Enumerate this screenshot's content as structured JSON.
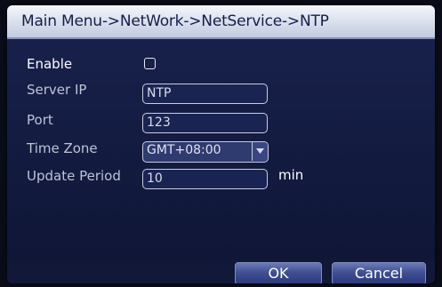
{
  "title": "Main Menu->NetWork->NetService->NTP",
  "form": {
    "enable_label": "Enable",
    "enable_checked": false,
    "server_ip_label": "Server IP",
    "server_ip_value": "NTP",
    "port_label": "Port",
    "port_value": "123",
    "time_zone_label": "Time Zone",
    "time_zone_value": "GMT+08:00",
    "update_period_label": "Update Period",
    "update_period_value": "10",
    "update_period_unit": "min"
  },
  "buttons": {
    "ok_label": "OK",
    "cancel_label": "Cancel"
  },
  "icons": {
    "dropdown": "chevron-down-icon"
  }
}
